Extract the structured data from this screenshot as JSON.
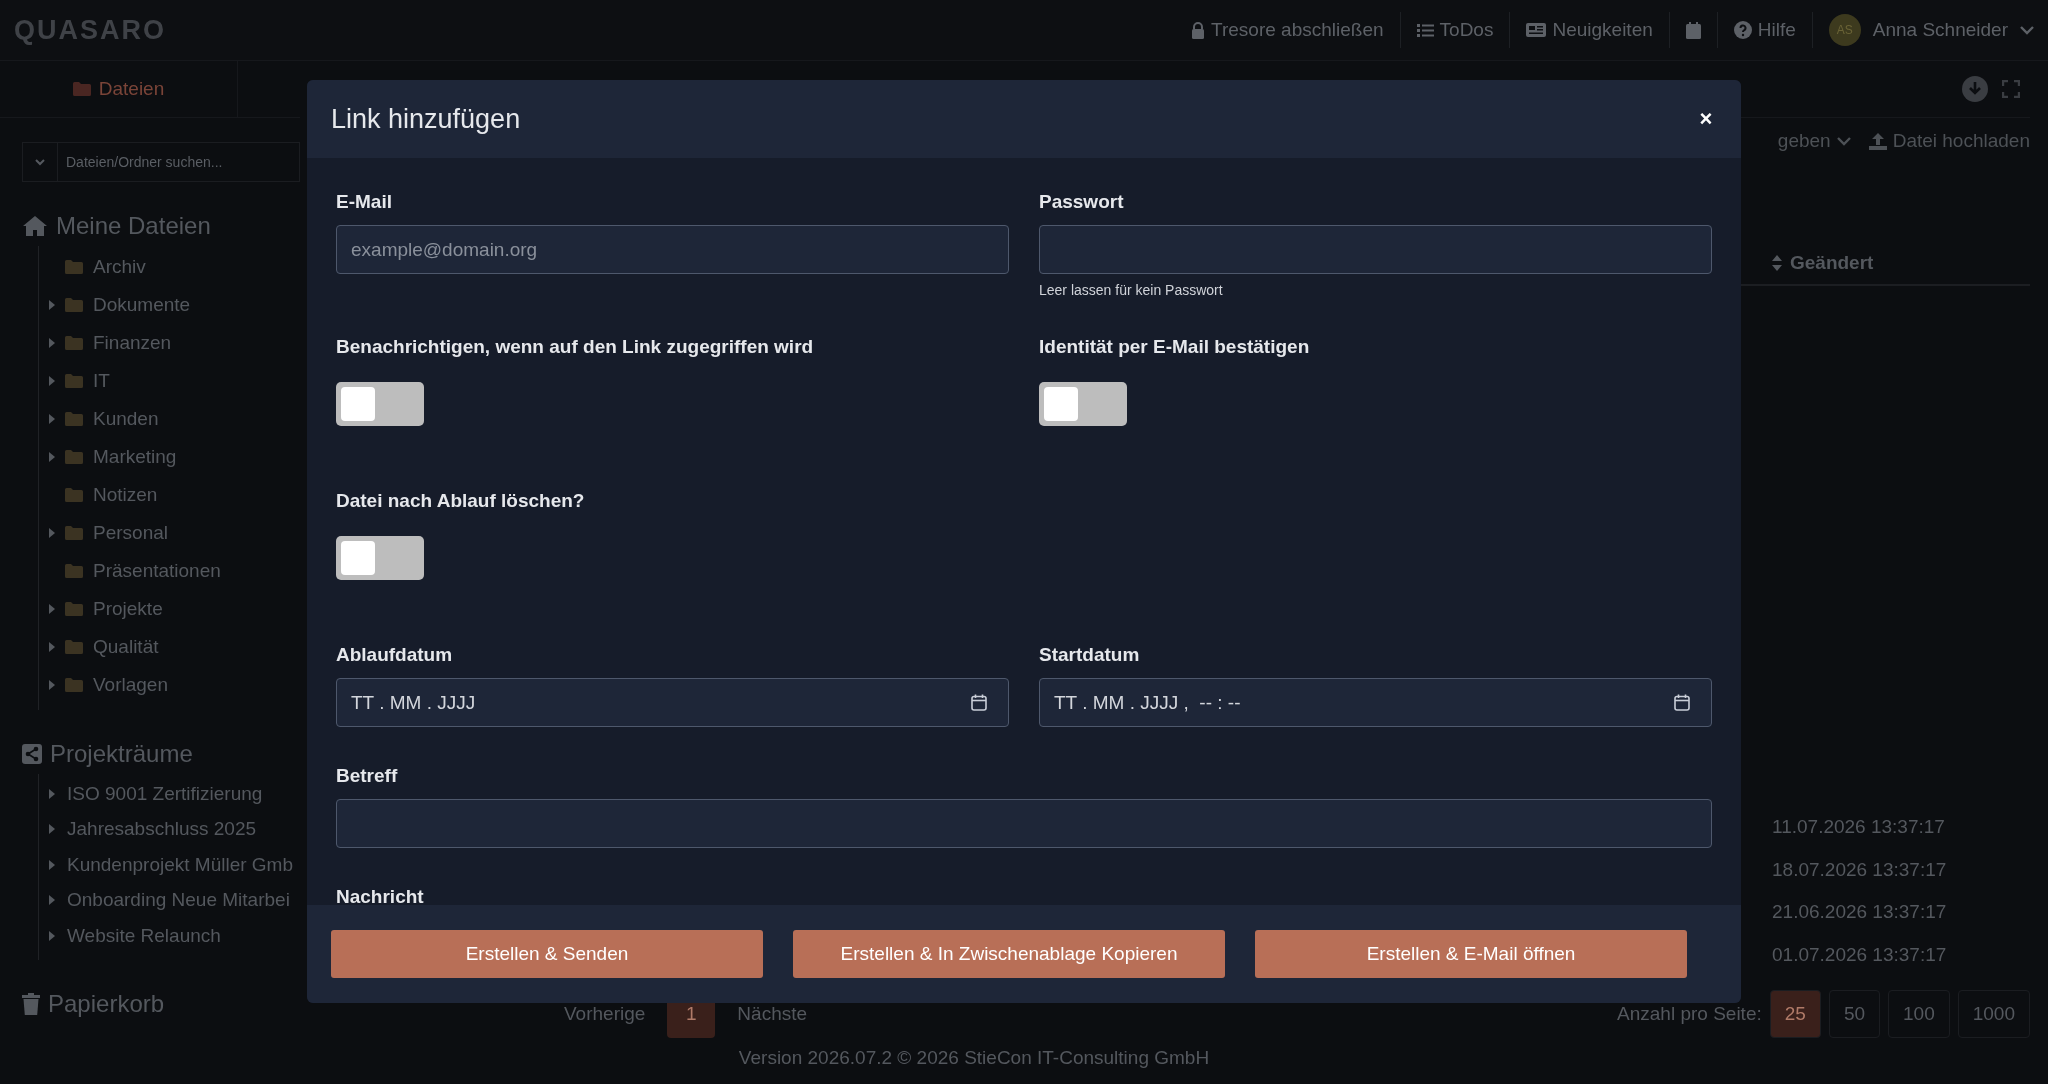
{
  "app": {
    "logo": "QUASARO"
  },
  "topbar": {
    "items": [
      {
        "kind": "lock",
        "label": "Tresore abschließen"
      },
      {
        "kind": "todo",
        "label": "ToDos"
      },
      {
        "kind": "news",
        "label": "Neuigkeiten"
      },
      {
        "kind": "calendar"
      },
      {
        "kind": "help",
        "label": "Hilfe"
      }
    ],
    "user": {
      "initials": "AS",
      "name": "Anna Schneider"
    }
  },
  "sidebar": {
    "tab": "Dateien",
    "search_placeholder": "Dateien/Ordner suchen...",
    "sections": [
      {
        "kind": "files",
        "title": "Meine Dateien",
        "items": [
          {
            "label": "Archiv",
            "has_children": false
          },
          {
            "label": "Dokumente",
            "has_children": true
          },
          {
            "label": "Finanzen",
            "has_children": true
          },
          {
            "label": "IT",
            "has_children": true
          },
          {
            "label": "Kunden",
            "has_children": true
          },
          {
            "label": "Marketing",
            "has_children": true
          },
          {
            "label": "Notizen",
            "has_children": false
          },
          {
            "label": "Personal",
            "has_children": true
          },
          {
            "label": "Präsentationen",
            "has_children": false
          },
          {
            "label": "Projekte",
            "has_children": true
          },
          {
            "label": "Qualität",
            "has_children": true
          },
          {
            "label": "Vorlagen",
            "has_children": true
          }
        ]
      },
      {
        "kind": "rooms",
        "title": "Projekträume",
        "items": [
          {
            "label": "ISO 9001 Zertifizierung",
            "has_children": true
          },
          {
            "label": "Jahresabschluss 2025",
            "has_children": true
          },
          {
            "label": "Kundenprojekt Müller Gmb",
            "has_children": true
          },
          {
            "label": "Onboarding Neue Mitarbei",
            "has_children": true
          },
          {
            "label": "Website Relaunch",
            "has_children": true
          }
        ]
      },
      {
        "kind": "trash",
        "title": "Papierkorb"
      }
    ]
  },
  "toolbar": {
    "share": "geben",
    "upload": "Datei hochladen"
  },
  "table": {
    "column": "Geändert",
    "rows": [
      "11.07.2026 13:37:17",
      "18.07.2026 13:37:17",
      "21.06.2026 13:37:17",
      "01.07.2026 13:37:17"
    ]
  },
  "pagination": {
    "prev": "Vorherige",
    "pages": [
      {
        "label": "1",
        "selected": true
      }
    ],
    "next": "Nächste",
    "per_page_label": "Anzahl pro Seite:",
    "per_page": [
      {
        "label": "25",
        "selected": true
      },
      {
        "label": "50",
        "selected": false
      },
      {
        "label": "100",
        "selected": false
      },
      {
        "label": "1000",
        "selected": false
      }
    ]
  },
  "footer": "Version 2026.07.2 © 2026 StieCon IT-Consulting GmbH",
  "dialog": {
    "title": "Link hinzufügen",
    "close": "×",
    "rows": [
      [
        {
          "kind": "text",
          "label": "E-Mail",
          "placeholder": "example@domain.org"
        },
        {
          "kind": "text",
          "label": "Passwort",
          "hint": "Leer lassen für kein Passwort"
        }
      ],
      [
        {
          "kind": "toggle",
          "label": "Benachrichtigen, wenn auf den Link zugegriffen wird",
          "on": false
        },
        {
          "kind": "toggle",
          "label": "Identität per E-Mail bestätigen",
          "on": false
        }
      ],
      [
        {
          "kind": "toggle",
          "label": "Datei nach Ablauf löschen?",
          "on": false
        }
      ],
      [
        {
          "kind": "date",
          "label": "Ablaufdatum",
          "placeholder": "TT . MM . JJJJ"
        },
        {
          "kind": "date",
          "label": "Startdatum",
          "placeholder": "TT . MM . JJJJ ,  -- : --"
        }
      ],
      [
        {
          "kind": "text",
          "label": "Betreff"
        }
      ],
      [
        {
          "kind": "label",
          "label": "Nachricht"
        }
      ]
    ],
    "buttons": [
      "Erstellen & Senden",
      "Erstellen & In Zwischenablage Kopieren",
      "Erstellen & E-Mail öffnen"
    ]
  }
}
